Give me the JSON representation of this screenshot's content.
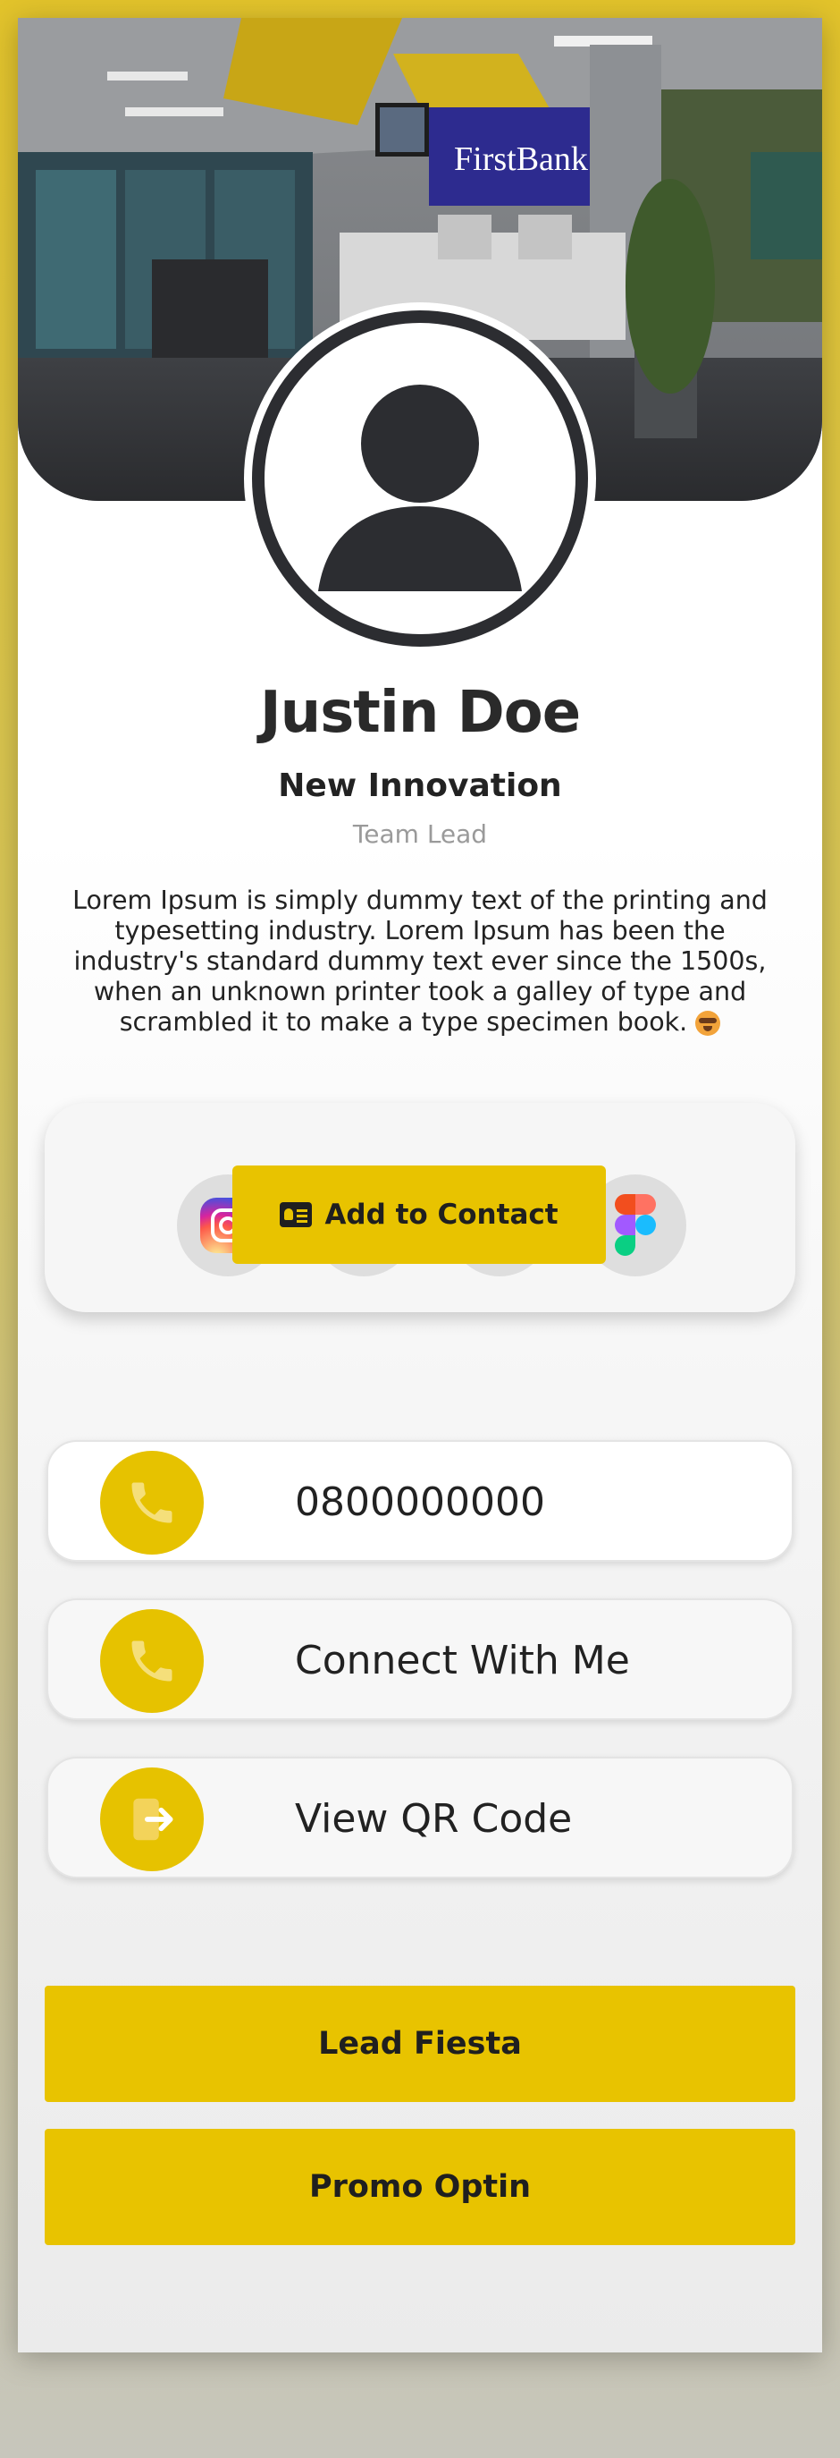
{
  "cover": {
    "bank_sign": "FirstBank"
  },
  "profile": {
    "name": "Justin Doe",
    "company": "New Innovation",
    "role": "Team Lead",
    "bio": "Lorem Ipsum is simply dummy text of the printing and typesetting industry. Lorem Ipsum has been the industry's standard dummy text ever since the 1500s, when an unknown printer took a galley of type and scrambled it to make a type specimen book."
  },
  "social": {
    "icons": [
      "instagram-icon",
      "figma-icon"
    ],
    "add_contact_label": "Add to Contact"
  },
  "actions": [
    {
      "label": "0800000000",
      "icon": "phone-icon"
    },
    {
      "label": "Connect With Me",
      "icon": "phone-icon"
    },
    {
      "label": "View QR Code",
      "icon": "exit-arrow-icon"
    }
  ],
  "buttons": {
    "lead": "Lead Fiesta",
    "promo": "Promo Optin"
  },
  "colors": {
    "accent": "#e8c300",
    "dark": "#2c2d31",
    "background_top": "#e2c32b"
  }
}
